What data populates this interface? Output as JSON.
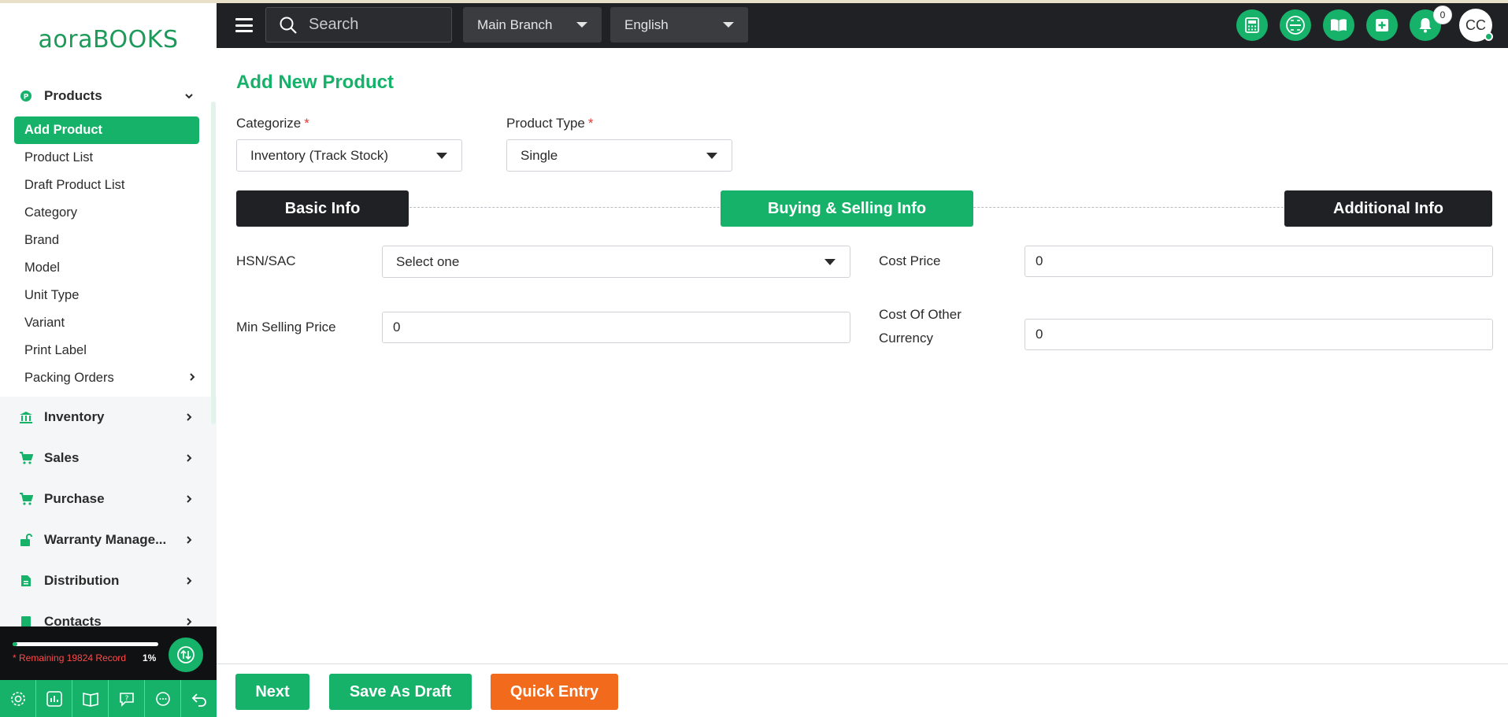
{
  "app": {
    "logo_prefix": "aora",
    "logo_suffix": "BOOKS"
  },
  "sidebar": {
    "products_label": "Products",
    "sub_items": [
      {
        "label": "Add Product",
        "active": true
      },
      {
        "label": "Product List"
      },
      {
        "label": "Draft Product List"
      },
      {
        "label": "Category"
      },
      {
        "label": "Brand"
      },
      {
        "label": "Model"
      },
      {
        "label": "Unit Type"
      },
      {
        "label": "Variant"
      },
      {
        "label": "Print Label"
      },
      {
        "label": "Packing Orders"
      }
    ],
    "sections": [
      {
        "label": "Inventory",
        "icon": "bank-icon"
      },
      {
        "label": "Sales",
        "icon": "cart-icon"
      },
      {
        "label": "Purchase",
        "icon": "cart-icon"
      },
      {
        "label": "Warranty Manage...",
        "icon": "unlock-icon"
      },
      {
        "label": "Distribution",
        "icon": "document-icon"
      },
      {
        "label": "Contacts",
        "icon": "contacts-icon"
      }
    ],
    "footer": {
      "remaining_text": "* Remaining 19824 Record",
      "percent_text": "1%",
      "progress_fraction": 0.01,
      "bottom_icons": [
        "settings-icon",
        "chart-icon",
        "book-icon",
        "help-icon",
        "chat-icon",
        "undo-icon"
      ]
    }
  },
  "topbar": {
    "search_placeholder": "Search",
    "branch": "Main Branch",
    "language": "English",
    "icons": [
      "calculator-icon",
      "scan-icon",
      "book-open-icon",
      "plus-square-icon",
      "bell-icon"
    ],
    "notification_count": "0",
    "avatar_initials": "CC"
  },
  "form": {
    "title": "Add New Product",
    "categorize_label": "Categorize",
    "categorize_value": "Inventory (Track Stock)",
    "product_type_label": "Product Type",
    "product_type_value": "Single",
    "required_mark": "*",
    "steps": [
      "Basic Info",
      "Buying & Selling Info",
      "Additional Info"
    ],
    "active_step": 1,
    "hsn_label": "HSN/SAC",
    "hsn_value": "Select one",
    "cost_price_label": "Cost Price",
    "cost_price_value": "0",
    "min_selling_label": "Min Selling Price",
    "min_selling_value": "0",
    "cost_other_label_1": "Cost Of Other",
    "cost_other_label_2": "Currency",
    "cost_other_value": "0"
  },
  "actions": {
    "next": "Next",
    "save_draft": "Save As Draft",
    "quick_entry": "Quick Entry"
  },
  "colors": {
    "accent": "#16b26a",
    "dark": "#1f2124",
    "orange": "#f26a1b",
    "danger": "#e53935"
  }
}
